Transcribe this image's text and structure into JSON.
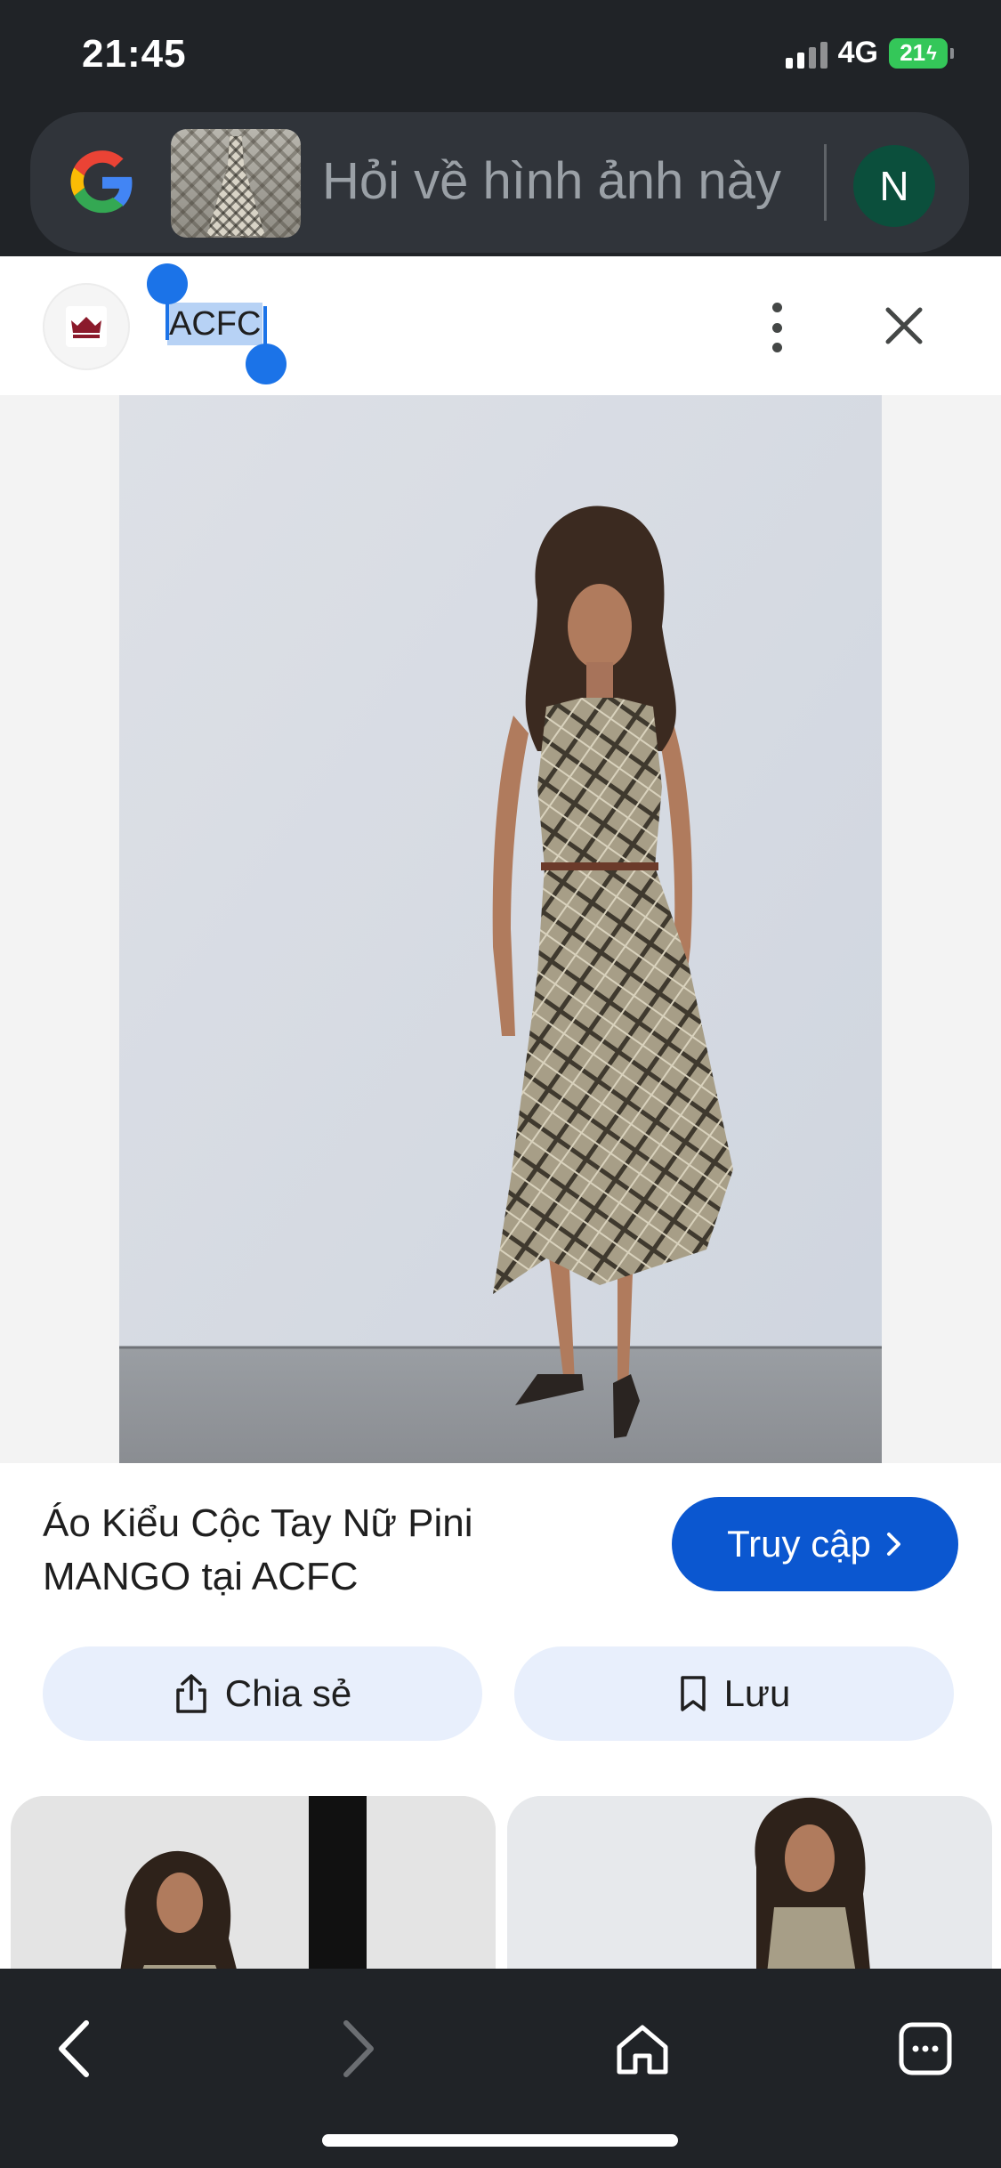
{
  "status_bar": {
    "time": "21:45",
    "network": "4G",
    "battery": "21"
  },
  "search": {
    "placeholder": "Hỏi về hình ảnh này",
    "avatar_letter": "N"
  },
  "source": {
    "site_name": "ACFC"
  },
  "result": {
    "title": "Áo Kiểu Cộc Tay Nữ Pini MANGO tại ACFC",
    "visit_label": "Truy cập",
    "share_label": "Chia sẻ",
    "save_label": "Lưu"
  },
  "icons": {
    "google": "google-logo-icon",
    "more": "more-vert-icon",
    "close": "close-icon",
    "share": "share-icon",
    "bookmark": "bookmark-icon",
    "back": "back-arrow-icon",
    "forward": "forward-arrow-icon",
    "home": "home-icon",
    "tabs": "tabs-icon"
  },
  "colors": {
    "accent": "#0b57d0",
    "pill_bg": "#e8effc",
    "dark_bg": "#202327",
    "selection": "#b7d2f5",
    "avatar_bg": "#0b4f3c"
  }
}
